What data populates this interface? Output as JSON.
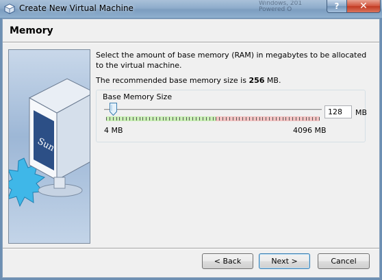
{
  "window": {
    "title": "Create New Virtual Machine",
    "background_window_lines": [
      "Windows, 201",
      "Powered O"
    ],
    "help_label": "?",
    "close_label": "✕"
  },
  "page": {
    "heading": "Memory",
    "description": "Select the amount of base memory (RAM) in megabytes to be allocated to the virtual machine.",
    "recommendation_prefix": "The recommended base memory size is ",
    "recommended_value": "256",
    "recommendation_suffix": " MB."
  },
  "memory_group": {
    "label": "Base Memory Size",
    "min_label": "4 MB",
    "max_label": "4096 MB",
    "value": "128",
    "unit": "MB",
    "slider_min": 4,
    "slider_max": 4096,
    "slider_value": 128
  },
  "buttons": {
    "back": "< Back",
    "next": "Next >",
    "cancel": "Cancel"
  },
  "colors": {
    "green_band": "#c9efb5",
    "red_band": "#f3c3c2",
    "default_button_border": "#3c7fb1"
  },
  "icons": {
    "title": "virtualbox-icon",
    "art": "virtualbox-sun-box-illustration",
    "thumb": "slider-thumb"
  }
}
